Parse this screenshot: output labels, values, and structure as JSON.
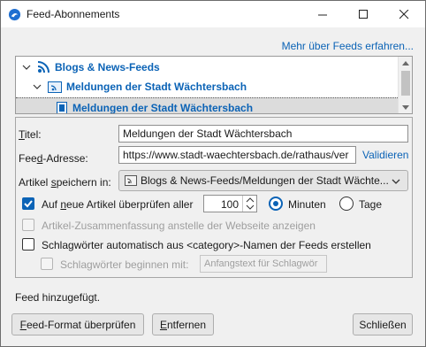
{
  "window": {
    "title": "Feed-Abonnements"
  },
  "header": {
    "more_link": "Mehr über Feeds erfahren..."
  },
  "tree": {
    "items": [
      {
        "label": "Blogs & News-Feeds",
        "icon": "rss-icon"
      },
      {
        "label": "Meldungen der Stadt Wächtersbach",
        "icon": "feed-folder-icon"
      },
      {
        "label": "Meldungen der Stadt Wächtersbach",
        "icon": "feed-item-icon"
      }
    ]
  },
  "form": {
    "title_label": {
      "pre": "",
      "acc": "T",
      "post": "itel:"
    },
    "title_value": "Meldungen der Stadt Wächtersbach",
    "address_label": {
      "pre": "Fee",
      "acc": "d",
      "post": "-Adresse:"
    },
    "address_value": "https://www.stadt-waechtersbach.de/rathaus/ver",
    "validate_label": "Validieren",
    "store_label": {
      "pre": "Artikel ",
      "acc": "s",
      "post": "peichern in:"
    },
    "store_value": "Blogs & News-Feeds/Meldungen der Stadt Wächte...",
    "check_label": {
      "pre": "Auf ",
      "acc": "n",
      "post": "eue Artikel überprüfen aller"
    },
    "check_interval": "100",
    "unit_minutes": "Minuten",
    "unit_days": "Tage",
    "summary_label": "Artikel-Zusammenfassung anstelle der Webseite anzeigen",
    "tags_label": "Schlagwörter automatisch aus <category>-Namen der Feeds erstellen",
    "prefix_label": "Schlagwörter beginnen mit:",
    "prefix_placeholder": "Anfangstext für Schlagwör"
  },
  "status": "Feed hinzugefügt.",
  "buttons": {
    "check_format": {
      "pre": "",
      "acc": "F",
      "post": "eed-Format überprüfen"
    },
    "remove": {
      "pre": "",
      "acc": "E",
      "post": "ntfernen"
    },
    "close": "Schließen"
  },
  "colors": {
    "accent": "#0b63b6",
    "link": "#0b63b6"
  }
}
